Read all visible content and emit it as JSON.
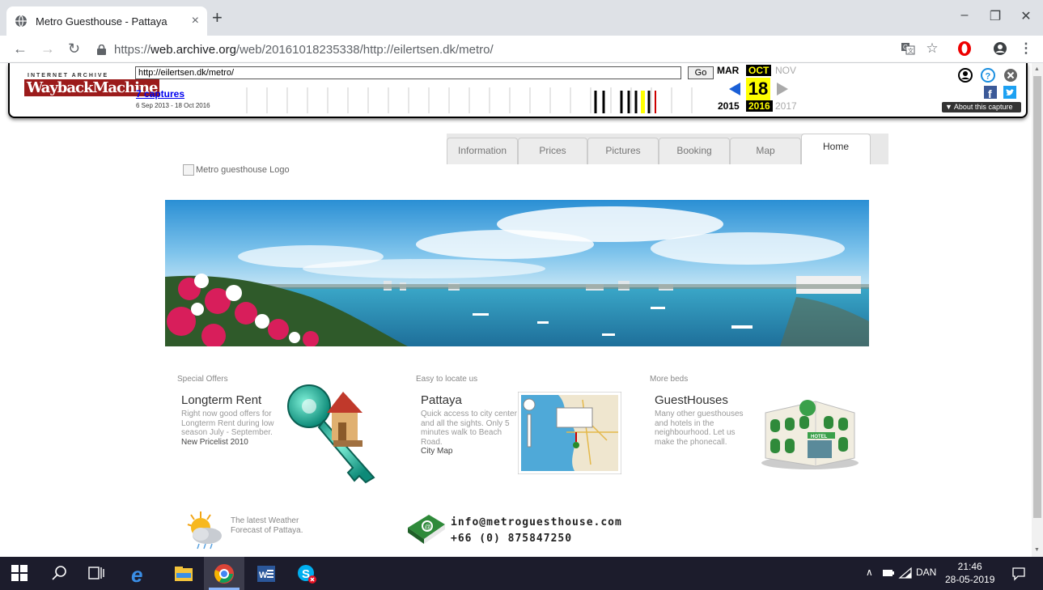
{
  "browser": {
    "tab_title": "Metro Guesthouse - Pattaya",
    "tab_close": "×",
    "new_tab": "+",
    "url_prefix": "https://",
    "url_host": "web.archive.org",
    "url_path": "/web/20161018235338/http://eilertsen.dk/metro/",
    "win_minimize": "–",
    "win_restore": "❐",
    "win_close": "✕"
  },
  "wayback": {
    "logo_top": "INTERNET ARCHIVE",
    "logo_main": "WaybackMachine",
    "url_value": "http://eilertsen.dk/metro/",
    "go_label": "Go",
    "captures_label": "7 captures",
    "date_range": "6 Sep 2013 - 18 Oct 2016",
    "prev_month": "MAR",
    "cur_month": "OCT",
    "next_month": "NOV",
    "day": "18",
    "prev_year": "2015",
    "cur_year": "2016",
    "next_year": "2017",
    "about_label": "▼ About this capture",
    "capture_bars": [
      0.76,
      0.8,
      0.83,
      0.86,
      0.89,
      0.915,
      0.935,
      0.955
    ]
  },
  "site": {
    "tabs": [
      "Information",
      "Prices",
      "Pictures",
      "Booking",
      "Map",
      "Home"
    ],
    "active_tab": "Home",
    "logo_alt": "Metro guesthouse Logo",
    "columns": [
      {
        "heading": "Special Offers",
        "title": "Longterm Rent",
        "body": "Right now good offers for Longterm Rent during low season July - September.",
        "link": "New Pricelist 2010"
      },
      {
        "heading": "Easy to locate us",
        "title": "Pattaya",
        "body": "Quick access to city center and all the sights. Only 5 minutes walk to Beach Road.",
        "link": "City Map"
      },
      {
        "heading": "More beds",
        "title": "GuestHouses",
        "body": "Many other guesthouses and hotels in the neighbourhood. Let us make the phonecall.",
        "link": ""
      }
    ],
    "weather_text": "The latest Weather Forecast of Pattaya.",
    "email": "info@metroguesthouse.com",
    "phone": "+66 (0) 875847250"
  },
  "taskbar": {
    "tray_lang": "DAN",
    "time": "21:46",
    "date": "28-05-2019"
  },
  "colors": {
    "taskbar_bg": "#1c1c2c",
    "wayback_red": "#9b1b1b",
    "link_blue": "#0000ee",
    "highlight_yellow": "#ffff00"
  }
}
